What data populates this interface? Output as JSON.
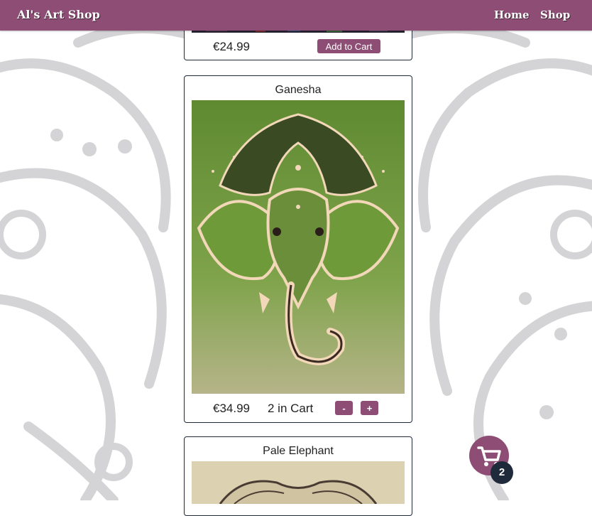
{
  "navbar": {
    "brand": "Al's Art Shop",
    "links": [
      "Home",
      "Shop"
    ]
  },
  "products": [
    {
      "price": "€24.99",
      "action_label": "Add to Cart"
    },
    {
      "title": "Ganesha",
      "price": "€34.99",
      "in_cart_text": "2 in Cart",
      "decrement_label": "-",
      "increment_label": "+"
    },
    {
      "title": "Pale Elephant"
    }
  ],
  "cart": {
    "count": "2"
  },
  "colors": {
    "brand": "#8e4d74",
    "dark": "#1f2a3a",
    "painting_green": "#6f9a3a"
  },
  "icons": {
    "cart": "shopping-cart-icon"
  }
}
